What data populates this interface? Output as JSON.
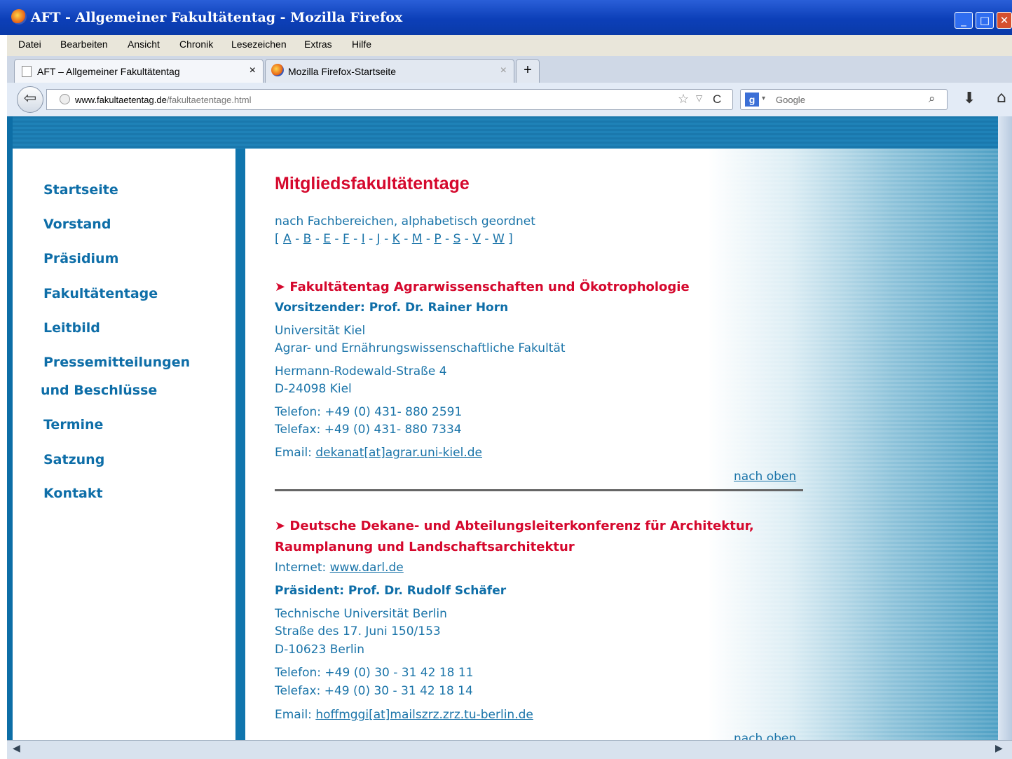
{
  "window": {
    "title": "AFT - Allgemeiner Fakultätentag - Mozilla Firefox"
  },
  "menu": [
    "Datei",
    "Bearbeiten",
    "Ansicht",
    "Chronik",
    "Lesezeichen",
    "Extras",
    "Hilfe"
  ],
  "tabs": [
    {
      "label": "AFT – Allgemeiner Fakultätentag",
      "close": "×"
    },
    {
      "label": "Mozilla Firefox-Startseite",
      "close": "×"
    }
  ],
  "newtab": "+",
  "url": {
    "domain": "www.fakultaetentag.de",
    "path": "/fakultaetentage.html"
  },
  "search": {
    "engine": "Google"
  },
  "sidebar": [
    "Startseite",
    "Vorstand",
    "Präsidium",
    "Fakultätentage",
    "Leitbild",
    "Pressemitteilungen",
    "und Beschlüsse",
    "Termine",
    "Satzung",
    "Kontakt"
  ],
  "content": {
    "title": "Mitgliedsfakultätentage",
    "subtitle": "nach Fachbereichen, alphabetisch geordnet",
    "alpha_open": "[",
    "alpha_close": "]",
    "alpha_sep": "-",
    "alphabet": [
      "A",
      "B",
      "E",
      "F",
      "I",
      "J",
      "K",
      "M",
      "P",
      "S",
      "V",
      "W"
    ],
    "entry1": {
      "heading": "Fakultätentag Agrarwissenschaften und Ökotrophologie",
      "chair": "Vorsitzender: Prof. Dr. Rainer Horn",
      "org1": "Universität Kiel",
      "org2": "Agrar- und Ernährungswissenschaftliche Fakultät",
      "street": "Hermann-Rodewald-Straße 4",
      "city": "D-24098 Kiel",
      "phone": "Telefon: +49 (0) 431- 880 2591",
      "fax": "Telefax: +49 (0) 431- 880 7334",
      "email_label": "Email:",
      "email": "dekanat[at]agrar.uni-kiel.de",
      "top": "nach oben"
    },
    "entry2": {
      "heading1": "Deutsche Dekane- und Abteilungsleiterkonferenz für Architektur,",
      "heading2": "Raumplanung und Landschaftsarchitektur",
      "internet_label": "Internet:",
      "internet": "www.darl.de",
      "chair": "Präsident: Prof. Dr. Rudolf Schäfer",
      "org": "Technische Universität Berlin",
      "street": "Straße des 17. Juni 150/153",
      "city": "D-10623 Berlin",
      "phone": "Telefon: +49 (0) 30 - 31 42 18 11",
      "fax": "Telefax: +49 (0) 30 - 31 42 18 14",
      "email_label": "Email:",
      "email": "hoffmggi[at]mailszrz.zrz.tu-berlin.de",
      "top": "nach oben"
    }
  }
}
